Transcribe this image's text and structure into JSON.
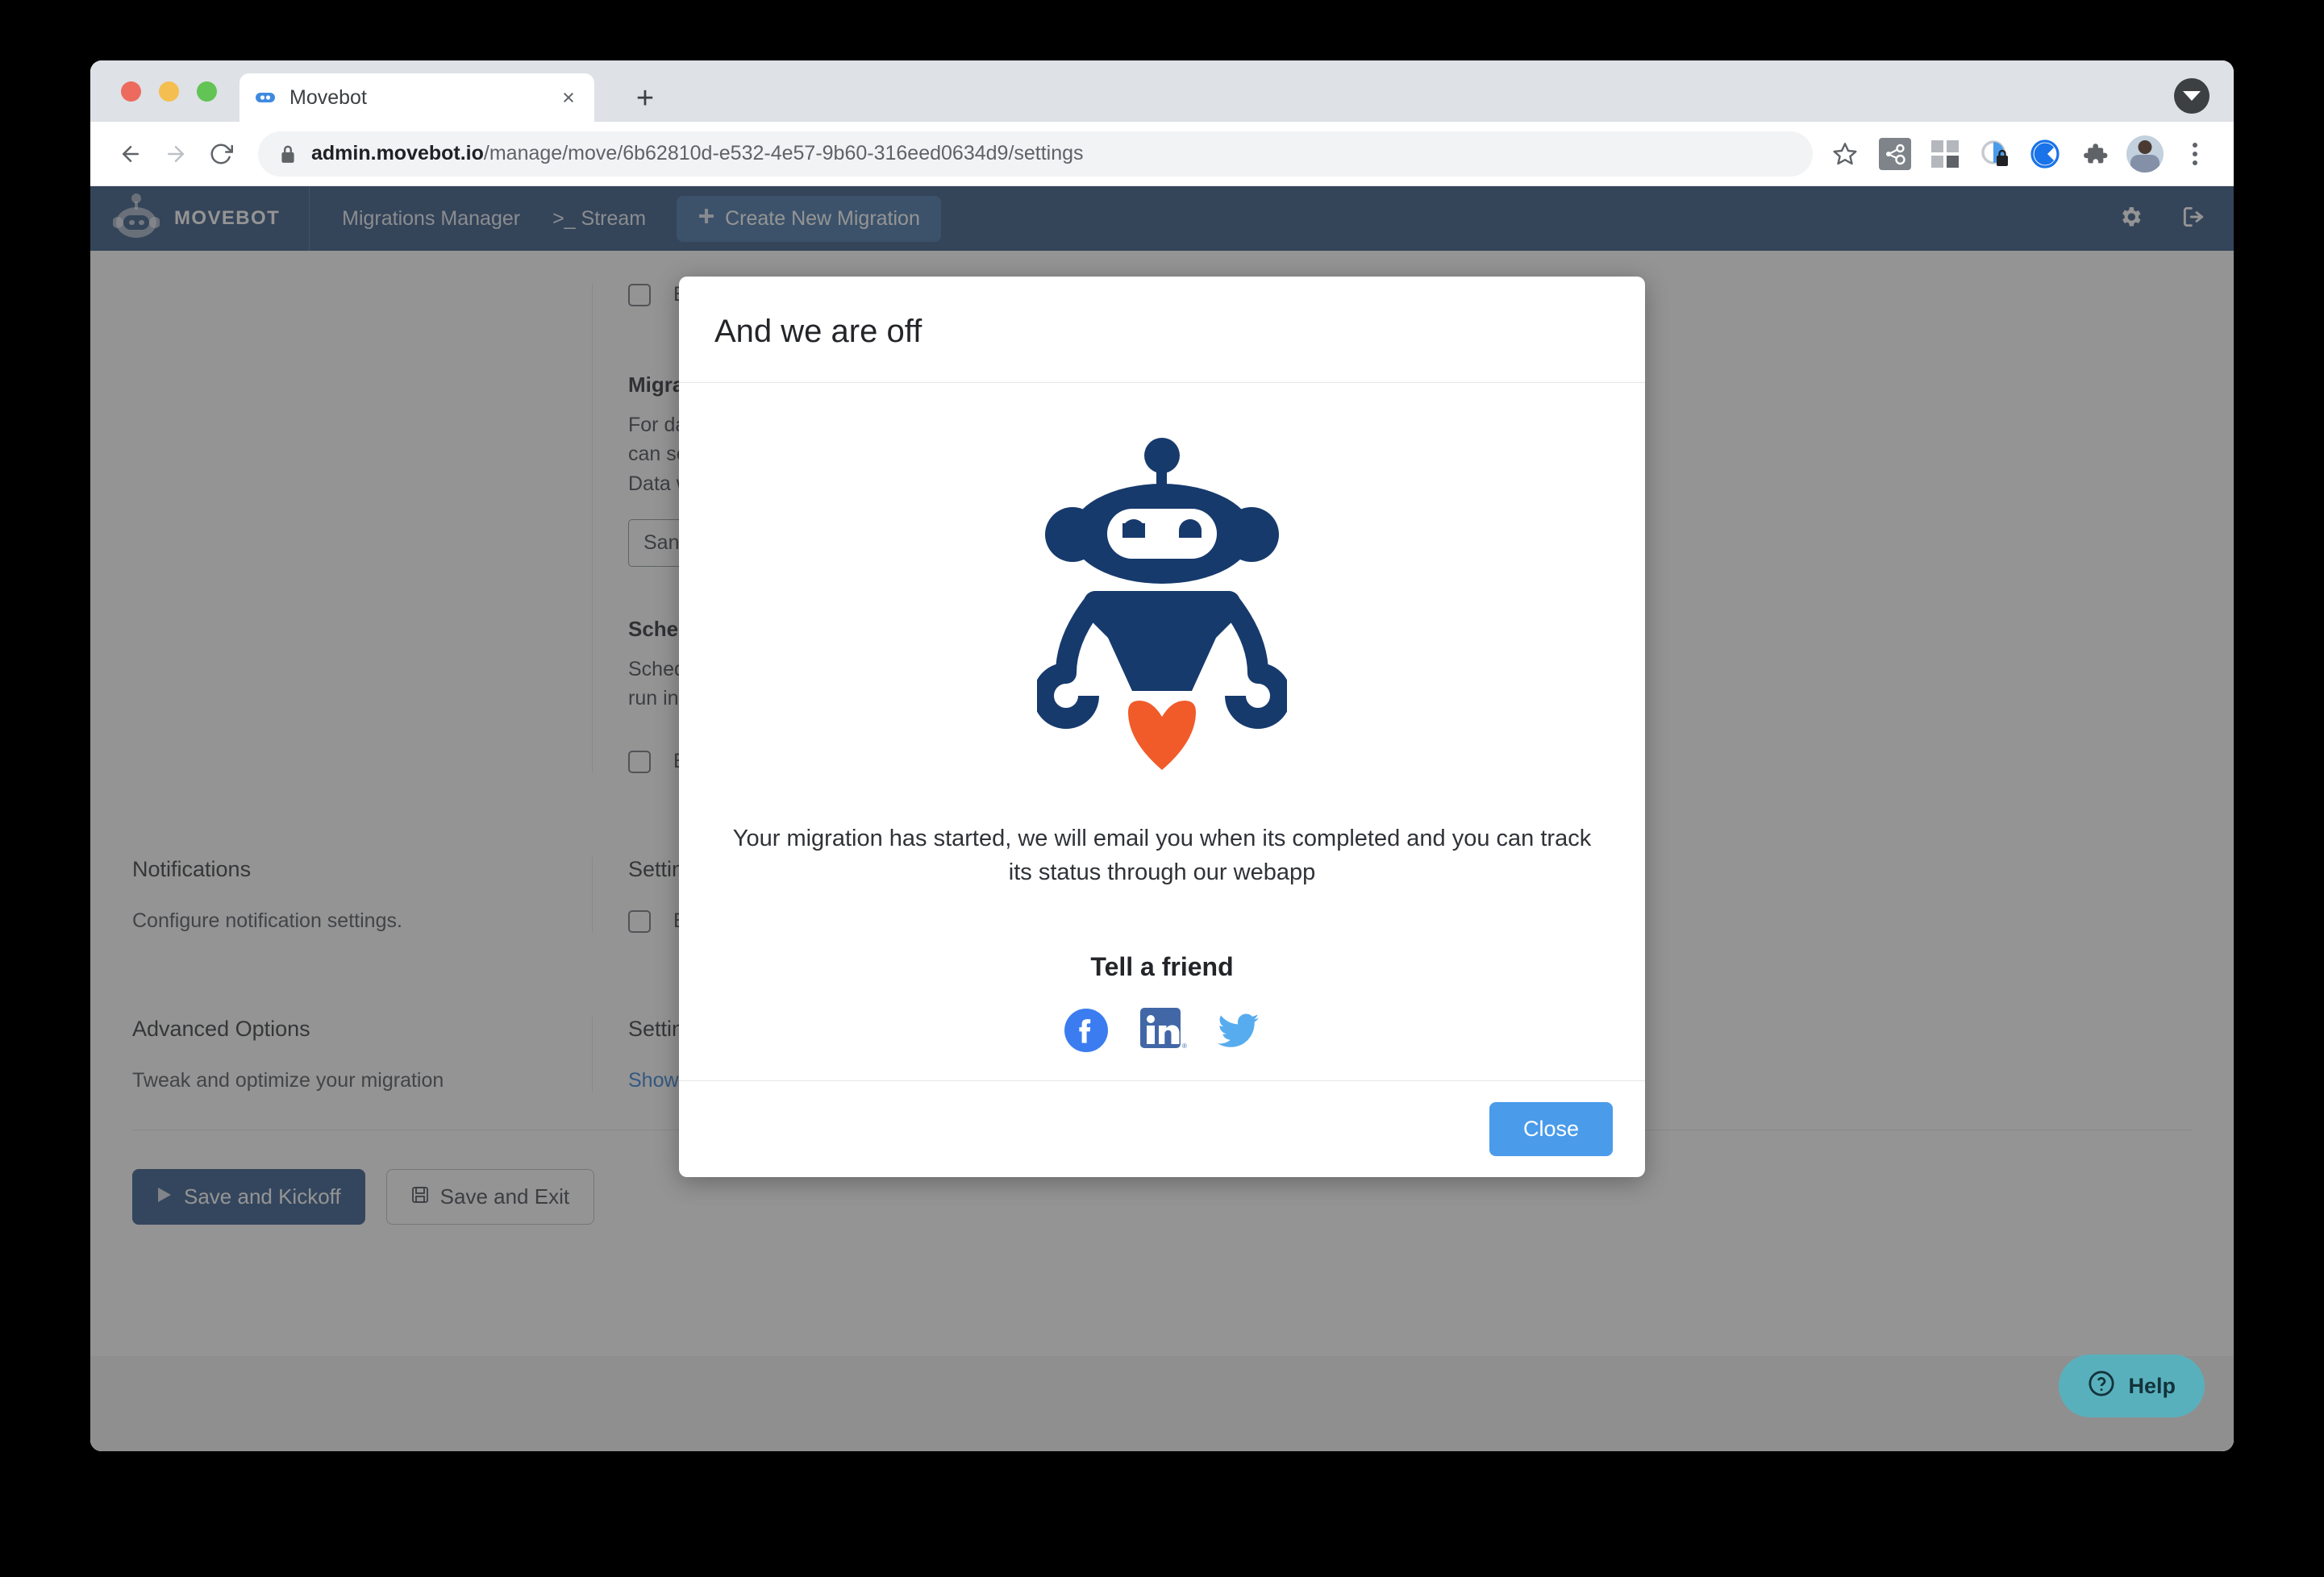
{
  "browser": {
    "tab": {
      "title": "Movebot",
      "favicon": "movebot-favicon",
      "close_label": "×"
    },
    "new_tab_label": "+",
    "url": {
      "domain": "admin.movebot.io",
      "path": "/manage/move/6b62810d-e532-4e57-9b60-316eed0634d9/settings"
    },
    "nav": {
      "back": "back-arrow",
      "forward": "forward-arrow",
      "reload": "reload"
    },
    "toolbar_icons": [
      "bookmark-star-icon",
      "hubspot-extension-icon",
      "grid-extension-icon",
      "privacy-lock-extension-icon",
      "c-extension-icon",
      "puzzle-extensions-icon",
      "profile-avatar",
      "chrome-menu-icon"
    ]
  },
  "app": {
    "brand": "MOVEBOT",
    "nav_links": [
      {
        "label": "Migrations Manager"
      },
      {
        "label": ">_ Stream"
      }
    ],
    "create_button": "Create New Migration",
    "navbar_right_icons": [
      "gear-icon",
      "sign-out-icon"
    ]
  },
  "page": {
    "top_checkbox_label": "Ena",
    "migration_section": {
      "title": "Migratio",
      "lines": [
        "For data",
        "can selec",
        "Data will"
      ],
      "input_value": "San Fran"
    },
    "schedule_section": {
      "title": "Schedul",
      "lines": [
        "Scheduli",
        "run in the"
      ],
      "checkbox_label": "Ena"
    },
    "rows": [
      {
        "title": "Notifications",
        "desc": "Configure notification settings.",
        "right_title": "Settings",
        "right_type": "checkbox",
        "right_value": "Em"
      },
      {
        "title": "Advanced Options",
        "desc": "Tweak and optimize your migration",
        "right_title": "Settings",
        "right_type": "link",
        "right_value": "Show Ad"
      }
    ],
    "actions": {
      "save_kickoff": "Save and Kickoff",
      "save_exit": "Save and Exit"
    }
  },
  "help_widget": {
    "label": "Help",
    "icon": "question-circle-icon"
  },
  "modal": {
    "title": "And we are off",
    "mascot": "movebot-rocket-robot",
    "message": "Your migration has started, we will email you when its completed and you can track its status through our webapp",
    "tell_a_friend": "Tell a friend",
    "social": [
      {
        "name": "facebook-icon"
      },
      {
        "name": "linkedin-icon"
      },
      {
        "name": "twitter-icon"
      }
    ],
    "close_label": "Close"
  },
  "colors": {
    "brand_navy": "#2b4f7d",
    "mascot_navy": "#173a6d",
    "mascot_flame": "#f15b2a",
    "modal_close_blue": "#4a9bea",
    "primary_button": "#2b5286",
    "link_blue": "#2e7bd6",
    "help_teal": "#59b0bd"
  }
}
